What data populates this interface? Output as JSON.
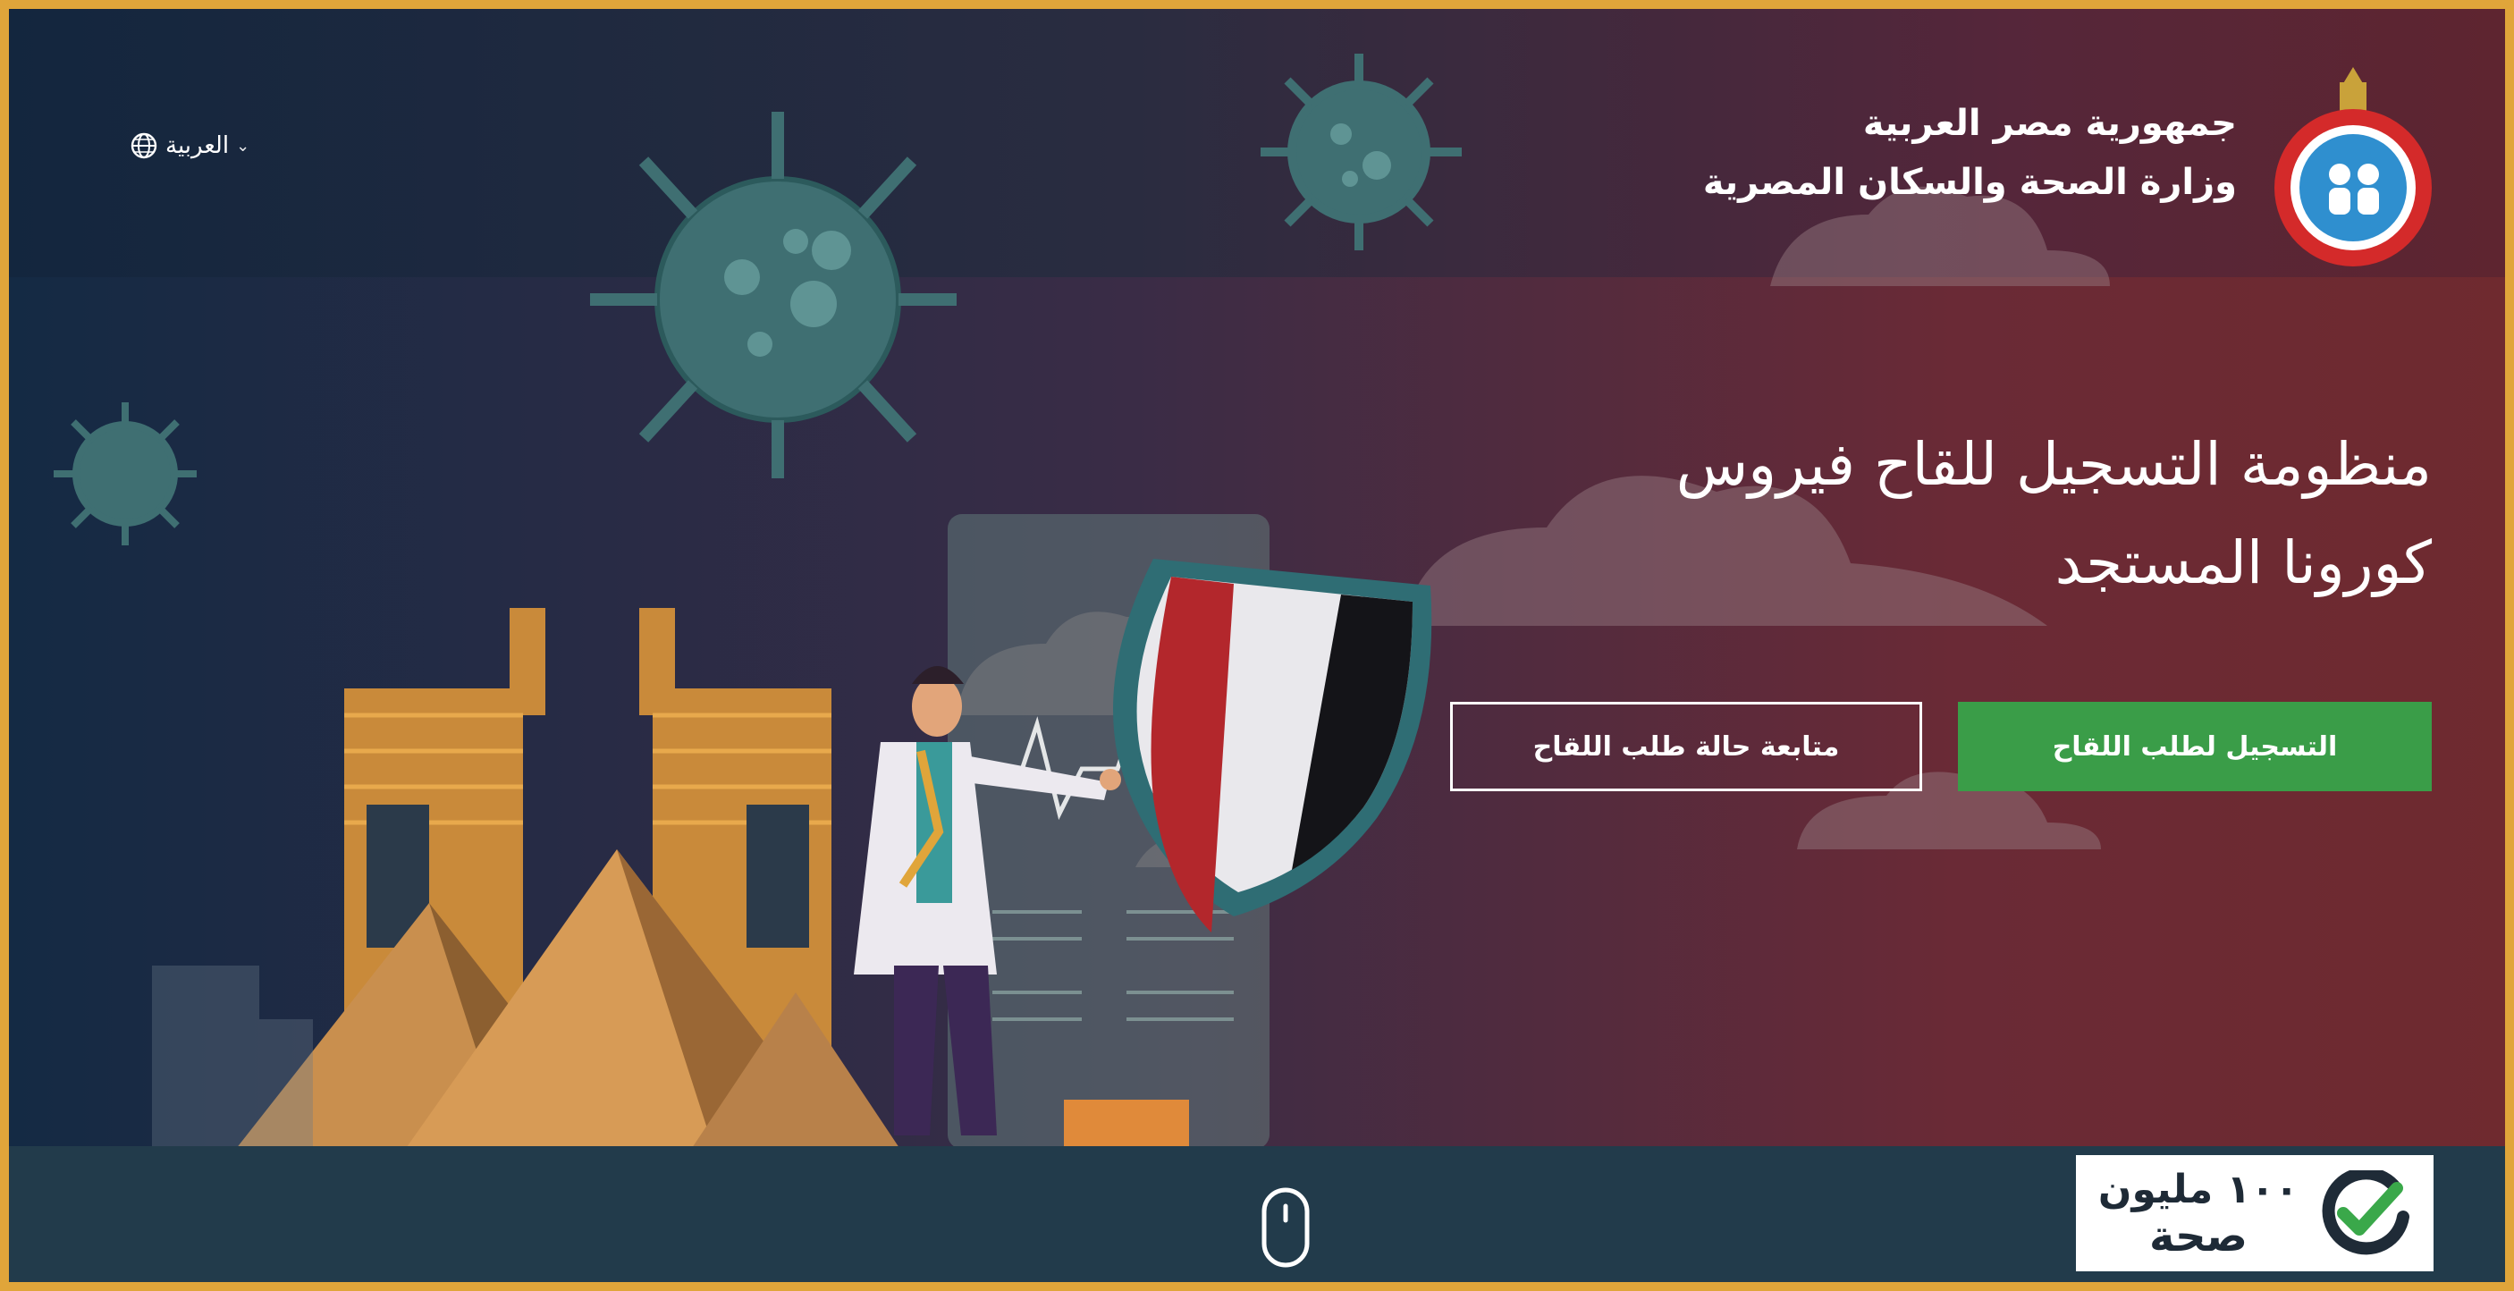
{
  "header": {
    "language_label": "العربية",
    "ministry_line1": "جمهورية مصر العربية",
    "ministry_line2": "وزارة الصحة والسكان المصرية"
  },
  "hero": {
    "title_line1": "منظومة التسجيل للقاح فيروس",
    "title_line2": "كورونا المستجد",
    "register_button": "التسجيل لطلب اللقاح",
    "track_button": "متابعة حالة طلب اللقاح"
  },
  "footer": {
    "badge_line1": "١٠٠ مليون",
    "badge_line2": "صحة"
  },
  "colors": {
    "accent_green": "#3a9d48",
    "frame_gold": "#e0a53a",
    "bottom_bar": "#223b4b"
  },
  "icons": [
    "globe-icon",
    "chevron-down-icon",
    "ministry-logo",
    "mouse-scroll-icon",
    "check-badge-icon",
    "virus-icon",
    "shield-flag-icon"
  ]
}
